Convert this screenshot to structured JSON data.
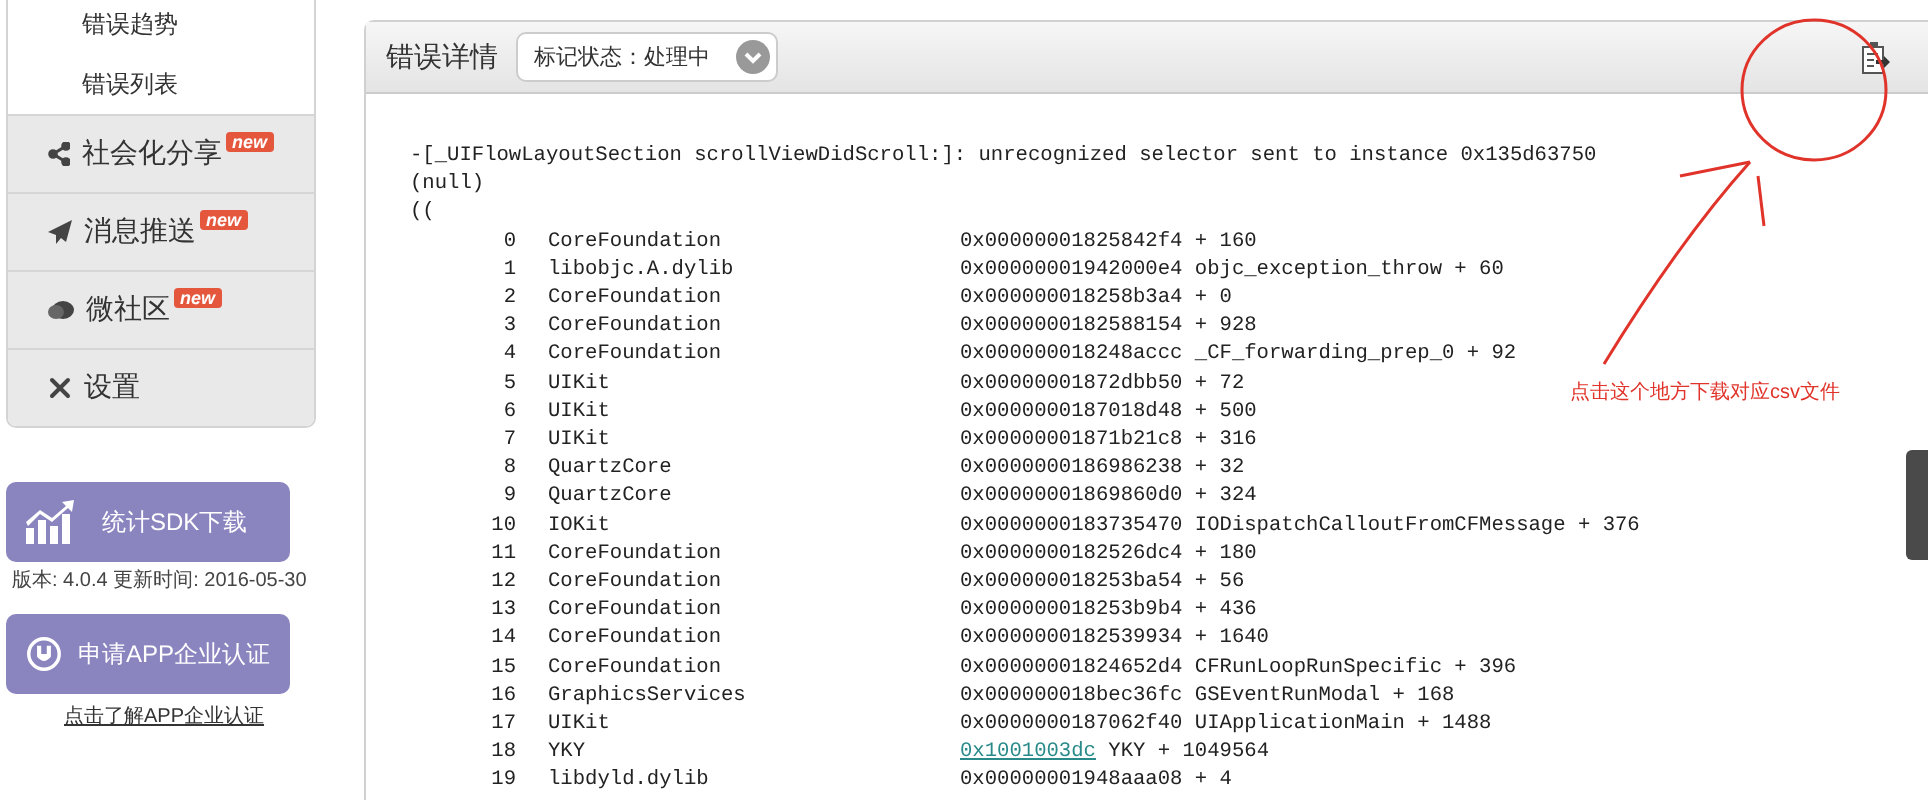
{
  "sidebar": {
    "sub_items": [
      {
        "label": "错误趋势"
      },
      {
        "label": "错误列表"
      }
    ],
    "menu": [
      {
        "label": "社会化分享",
        "kind": "share",
        "badge": "new"
      },
      {
        "label": "消息推送",
        "kind": "send",
        "badge": "new"
      },
      {
        "label": "微社区",
        "kind": "chat",
        "badge": "new"
      },
      {
        "label": "设置",
        "kind": "tools"
      }
    ],
    "sdk_button": "统计SDK下载",
    "version": "版本: 4.0.4 更新时间: 2016-05-30",
    "cert_button": "申请APP企业认证",
    "cert_link": "点击了解APP企业认证"
  },
  "panel": {
    "title": "错误详情",
    "status_select": "标记状态：处理中",
    "message": [
      "-[_UIFlowLayoutSection scrollViewDidScroll:]: unrecognized selector sent to instance 0x135d63750",
      "(null)",
      "(("
    ],
    "frames": [
      {
        "index": "0",
        "library": "CoreFoundation",
        "address": "0x00000001825842f4",
        "symbol": " + 160",
        "linked": false
      },
      {
        "index": "1",
        "library": "libobjc.A.dylib",
        "address": "0x00000001942000e4",
        "symbol": "objc_exception_throw + 60",
        "linked": false
      },
      {
        "index": "2",
        "library": "CoreFoundation",
        "address": "0x000000018258b3a4",
        "symbol": " + 0",
        "linked": false
      },
      {
        "index": "3",
        "library": "CoreFoundation",
        "address": "0x0000000182588154",
        "symbol": " + 928",
        "linked": false
      },
      {
        "index": "4",
        "library": "CoreFoundation",
        "address": "0x000000018248accc",
        "symbol": "_CF_forwarding_prep_0 + 92",
        "linked": false
      },
      {
        "index": "5",
        "library": "UIKit",
        "address": "0x00000001872dbb50",
        "symbol": " + 72",
        "linked": false
      },
      {
        "index": "6",
        "library": "UIKit",
        "address": "0x0000000187018d48",
        "symbol": " + 500",
        "linked": false
      },
      {
        "index": "7",
        "library": "UIKit",
        "address": "0x00000001871b21c8",
        "symbol": " + 316",
        "linked": false
      },
      {
        "index": "8",
        "library": "QuartzCore",
        "address": "0x0000000186986238",
        "symbol": " + 32",
        "linked": false
      },
      {
        "index": "9",
        "library": "QuartzCore",
        "address": "0x00000001869860d0",
        "symbol": " + 324",
        "linked": false
      },
      {
        "index": "10",
        "library": "IOKit",
        "address": "0x0000000183735470",
        "symbol": "IODispatchCalloutFromCFMessage + 376",
        "linked": false
      },
      {
        "index": "11",
        "library": "CoreFoundation",
        "address": "0x0000000182526dc4",
        "symbol": " + 180",
        "linked": false
      },
      {
        "index": "12",
        "library": "CoreFoundation",
        "address": "0x000000018253ba54",
        "symbol": " + 56",
        "linked": false
      },
      {
        "index": "13",
        "library": "CoreFoundation",
        "address": "0x000000018253b9b4",
        "symbol": " + 436",
        "linked": false
      },
      {
        "index": "14",
        "library": "CoreFoundation",
        "address": "0x0000000182539934",
        "symbol": " + 1640",
        "linked": false
      },
      {
        "index": "15",
        "library": "CoreFoundation",
        "address": "0x00000001824652d4",
        "symbol": "CFRunLoopRunSpecific + 396",
        "linked": false
      },
      {
        "index": "16",
        "library": "GraphicsServices",
        "address": "0x000000018bec36fc",
        "symbol": "GSEventRunModal + 168",
        "linked": false
      },
      {
        "index": "17",
        "library": "UIKit",
        "address": "0x0000000187062f40",
        "symbol": "UIApplicationMain + 1488",
        "linked": false
      },
      {
        "index": "18",
        "library": "YKY",
        "address": "0x1001003dc",
        "symbol": "YKY + 1049564",
        "linked": true
      },
      {
        "index": "19",
        "library": "libdyld.dylib",
        "address": "0x00000001948aaa08",
        "symbol": " + 4",
        "linked": false
      }
    ]
  },
  "annotation": {
    "note": "点击这个地方下载对应csv文件"
  }
}
